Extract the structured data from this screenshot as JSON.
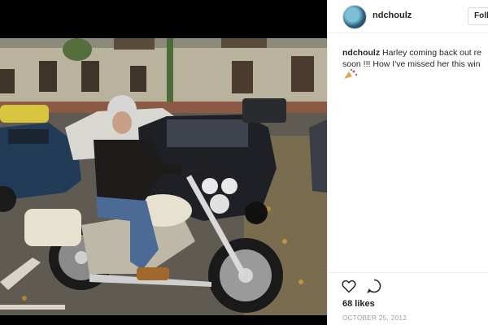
{
  "post": {
    "username": "ndchoulz",
    "follow_label": "Follow",
    "caption_user": "ndchoulz",
    "caption_line1": "Harley coming back out re",
    "caption_line2": "soon !!! How I've missed her this win",
    "emoji_name": "party-emoji",
    "likes": "68 likes",
    "date": "OCTOBER 25, 2012"
  },
  "icons": {
    "like": "heart-icon",
    "comment": "comment-icon"
  },
  "colors": {
    "panel_bg": "#ffffff",
    "text": "#262626",
    "muted": "#999999",
    "viewer_bg": "#000000"
  }
}
